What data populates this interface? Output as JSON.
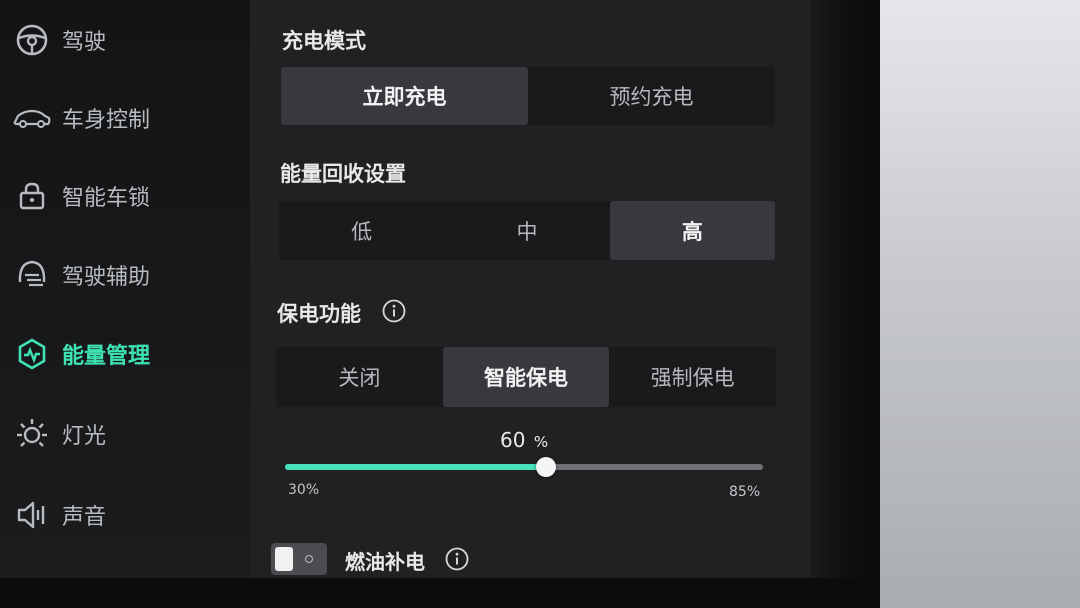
{
  "sidebar": {
    "items": [
      {
        "label": "驾驶",
        "icon": "steering-wheel-icon"
      },
      {
        "label": "车身控制",
        "icon": "car-icon"
      },
      {
        "label": "智能车锁",
        "icon": "lock-icon"
      },
      {
        "label": "驾驶辅助",
        "icon": "driver-assist-icon"
      },
      {
        "label": "能量管理",
        "icon": "energy-pulse-icon",
        "active": true
      },
      {
        "label": "灯光",
        "icon": "sun-light-icon"
      },
      {
        "label": "声音",
        "icon": "speaker-icon"
      }
    ]
  },
  "charge_mode": {
    "title": "充电模式",
    "options": [
      "立即充电",
      "预约充电"
    ],
    "selected": "立即充电"
  },
  "energy_recovery": {
    "title": "能量回收设置",
    "options": [
      "低",
      "中",
      "高"
    ],
    "selected": "高"
  },
  "battery_save": {
    "title": "保电功能",
    "options": [
      "关闭",
      "智能保电",
      "强制保电"
    ],
    "selected": "智能保电",
    "slider": {
      "value_text": "60",
      "unit": "%",
      "value": 60,
      "min": 30,
      "max": 85,
      "min_label": "30%",
      "max_label": "85%"
    }
  },
  "fuel_charge": {
    "label": "燃油补电",
    "enabled": false
  },
  "colors": {
    "accent": "#3ee3b4",
    "slider_fill": "#46e0bb",
    "panel": "#202123"
  }
}
